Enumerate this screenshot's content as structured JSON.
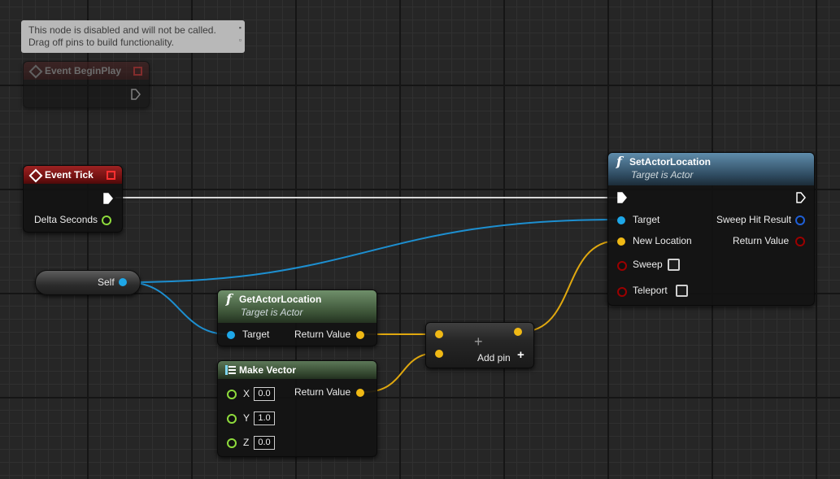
{
  "tooltip": {
    "line1": "This node is disabled and will not be called.",
    "line2": "Drag off pins to build functionality."
  },
  "event_beginplay": {
    "title": "Event BeginPlay",
    "disabled": true
  },
  "event_tick": {
    "title": "Event Tick",
    "delta_label": "Delta Seconds"
  },
  "self_node": {
    "label": "Self"
  },
  "set_actor_location": {
    "title": "SetActorLocation",
    "subtitle": "Target is Actor",
    "target_label": "Target",
    "new_location_label": "New Location",
    "sweep_label": "Sweep",
    "teleport_label": "Teleport",
    "sweep_hit_label": "Sweep Hit Result",
    "return_label": "Return Value"
  },
  "get_actor_location": {
    "title": "GetActorLocation",
    "subtitle": "Target is Actor",
    "target_label": "Target",
    "return_label": "Return Value"
  },
  "make_vector": {
    "title": "Make Vector",
    "return_label": "Return Value",
    "x_label": "X",
    "x_value": "0.0",
    "y_label": "Y",
    "y_value": "1.0",
    "z_label": "Z",
    "z_value": "0.0"
  },
  "add_node": {
    "plus": "+",
    "add_pin_label": "Add pin"
  },
  "colors": {
    "object_pin": "#1ea7e8",
    "vector_pin": "#f0b915",
    "float_pin": "#8edb3c",
    "bool_pin": "#9b0000",
    "struct_pin": "#1f5fd6",
    "exec_wire": "#e6e6e6"
  }
}
